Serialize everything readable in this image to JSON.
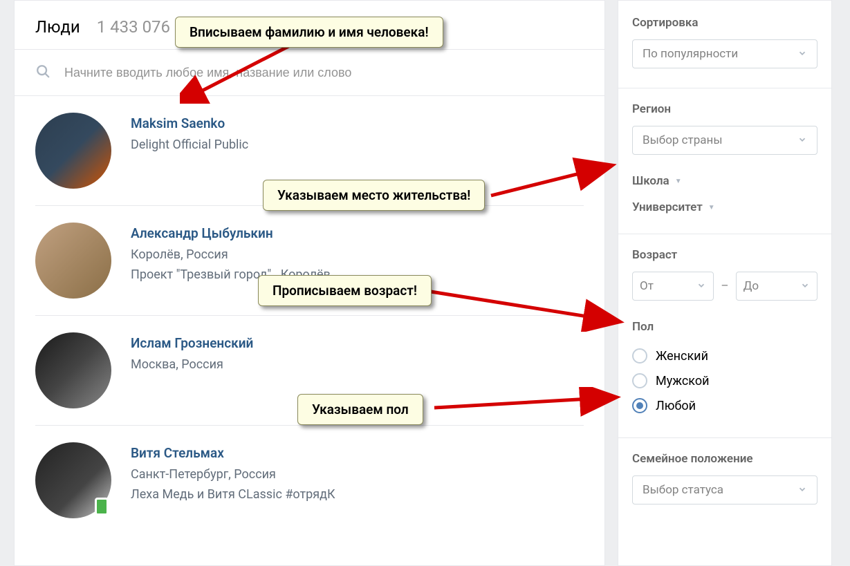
{
  "header": {
    "title": "Люди",
    "count": "1 433 076"
  },
  "search": {
    "placeholder": "Начните вводить любое имя, название или слово"
  },
  "results": [
    {
      "name": "Maksim Saenko",
      "line1": "Delight Official Public",
      "line2": ""
    },
    {
      "name": "Александр Цыбулькин",
      "line1": "Королёв, Россия",
      "line2": "Проект \"Трезвый город\" . Королёв"
    },
    {
      "name": "Ислам Грозненский",
      "line1": "Москва, Россия",
      "line2": ""
    },
    {
      "name": "Витя Стельмах",
      "line1": "Санкт-Петербург, Россия",
      "line2": "Леха Медь и Витя CLassic #отрядК"
    }
  ],
  "filters": {
    "sort_label": "Сортировка",
    "sort_value": "По популярности",
    "region_label": "Регион",
    "region_value": "Выбор страны",
    "school_label": "Школа",
    "university_label": "Университет",
    "age_label": "Возраст",
    "age_from": "От",
    "age_to": "До",
    "age_dash": "–",
    "gender_label": "Пол",
    "gender_options": {
      "female": "Женский",
      "male": "Мужской",
      "any": "Любой"
    },
    "marital_label": "Семейное положение",
    "marital_value": "Выбор статуса"
  },
  "callouts": {
    "c1": "Вписываем фамилию и имя человека!",
    "c2": "Указываем место жительства!",
    "c3": "Прописываем возраст!",
    "c4": "Указываем пол"
  }
}
